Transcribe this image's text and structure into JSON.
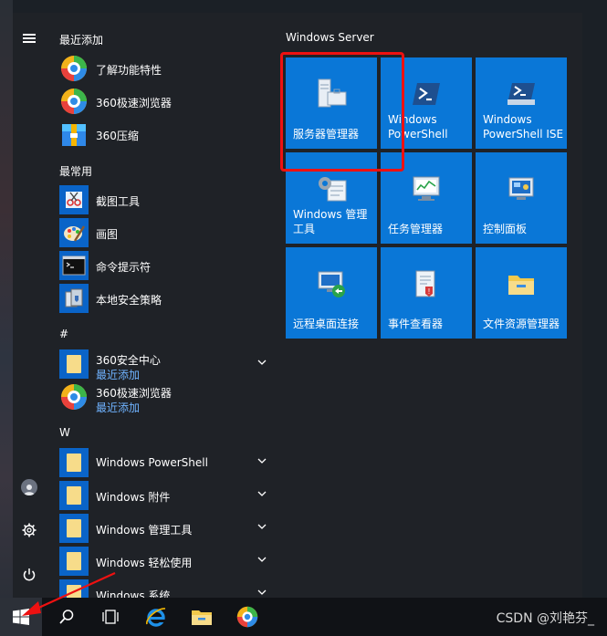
{
  "recent": {
    "header": "最近添加",
    "items": [
      {
        "label": "了解功能特性",
        "icon": "feature-icon"
      },
      {
        "label": "360极速浏览器",
        "icon": "browser-360-icon"
      },
      {
        "label": "360压缩",
        "icon": "zip-360-icon"
      }
    ]
  },
  "frequent": {
    "header": "最常用",
    "items": [
      {
        "label": "截图工具",
        "icon": "snipping-tool-icon"
      },
      {
        "label": "画图",
        "icon": "paint-icon"
      },
      {
        "label": "命令提示符",
        "icon": "cmd-icon"
      },
      {
        "label": "本地安全策略",
        "icon": "security-policy-icon"
      }
    ]
  },
  "hash_group": {
    "header": "#",
    "items": [
      {
        "label": "360安全中心",
        "sub": "最近添加",
        "icon": "folder-icon"
      },
      {
        "label": "360极速浏览器",
        "sub": "最近添加",
        "icon": "browser-360-icon"
      }
    ]
  },
  "w_group": {
    "header": "W",
    "items": [
      {
        "label": "Windows PowerShell",
        "icon": "folder-icon"
      },
      {
        "label": "Windows 附件",
        "icon": "folder-icon"
      },
      {
        "label": "Windows 管理工具",
        "icon": "folder-icon"
      },
      {
        "label": "Windows 轻松使用",
        "icon": "folder-icon"
      },
      {
        "label": "Windows 系统",
        "icon": "folder-icon"
      }
    ]
  },
  "tiles": {
    "group_label": "Windows Server",
    "items": [
      {
        "line1": "服务器管理器",
        "line2": "",
        "icon": "server-manager-icon"
      },
      {
        "line1": "Windows",
        "line2": "PowerShell",
        "icon": "powershell-icon"
      },
      {
        "line1": "Windows",
        "line2": "PowerShell ISE",
        "icon": "powershell-ise-icon"
      },
      {
        "line1": "Windows 管理",
        "line2": "工具",
        "icon": "admin-tools-icon"
      },
      {
        "line1": "任务管理器",
        "line2": "",
        "icon": "task-manager-icon"
      },
      {
        "line1": "控制面板",
        "line2": "",
        "icon": "control-panel-icon"
      },
      {
        "line1": "远程桌面连接",
        "line2": "",
        "icon": "remote-desktop-icon"
      },
      {
        "line1": "事件查看器",
        "line2": "",
        "icon": "event-viewer-icon"
      },
      {
        "line1": "文件资源管理器",
        "line2": "",
        "icon": "file-explorer-icon"
      }
    ]
  },
  "taskbar": {
    "watermark": "CSDN @刘艳芬_"
  },
  "colors": {
    "tile_blue": "#0a77d7",
    "highlight_red": "#e11111",
    "sub_text_blue": "#6fb3ff"
  }
}
